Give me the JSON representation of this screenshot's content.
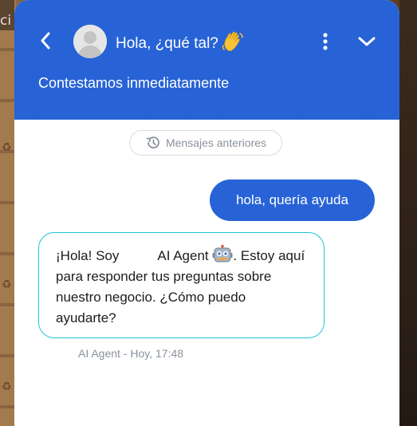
{
  "header": {
    "title": "Hola, ¿qué tal?",
    "subtitle": "Contestamos inmediatamente",
    "background_color": "#2763d6"
  },
  "icons": {
    "back": "chevron-left-icon",
    "avatar": "user-avatar-icon",
    "wave": "waving-hand-emoji",
    "menu": "vertical-dots-icon",
    "collapse": "chevron-down-icon",
    "history": "history-icon",
    "robot": "robot-emoji"
  },
  "history": {
    "label": "Mensajes anteriores"
  },
  "messages": [
    {
      "from": "user",
      "text": "hola, quería ayuda",
      "color": "#2763d6"
    },
    {
      "from": "bot",
      "text_before_gap": "¡Hola! Soy",
      "agent_name": "AI Agent",
      "text_after": ". Estoy aquí para responder tus preguntas sobre nuestro negocio. ¿Cómo puedo ayudarte?",
      "border_color": "#1ec4d8",
      "meta": "AI Agent - Hoy, 17:48"
    }
  ],
  "background_text": "ci"
}
